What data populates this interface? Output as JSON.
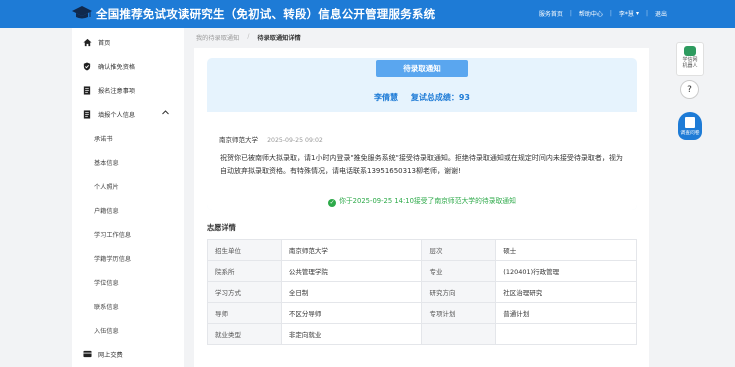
{
  "header": {
    "title": "全国推荐免试攻读研究生（免初试、转段）信息公开管理服务系统",
    "nav": [
      "服务首页",
      "帮助中心",
      "李*慧",
      "退出"
    ]
  },
  "sidebar": {
    "items": [
      {
        "label": "首页",
        "icon": "home-icon"
      },
      {
        "label": "确认推免资格",
        "icon": "shield-icon"
      },
      {
        "label": "报名注意事项",
        "icon": "document-icon"
      },
      {
        "label": "填报个人信息",
        "icon": "document-icon"
      },
      {
        "label": "承诺书"
      },
      {
        "label": "基本信息"
      },
      {
        "label": "个人照片"
      },
      {
        "label": "户籍信息"
      },
      {
        "label": "学习工作信息"
      },
      {
        "label": "学籍学历信息"
      },
      {
        "label": "学位信息"
      },
      {
        "label": "联系信息"
      },
      {
        "label": "入伍信息"
      },
      {
        "label": "网上交费",
        "icon": "payment-icon"
      }
    ]
  },
  "breadcrumb": {
    "parent": "我的待录取通知",
    "current": "待录取通知详情"
  },
  "notice": {
    "ribbon": "待录取通知",
    "student": "李倩慧",
    "score_label": "复试总成绩：93",
    "school": "南京师范大学",
    "time": "2025-09-25 09:02",
    "body": "祝贺你已被南师大拟录取，请1小时内登录\"推免服务系统\"接受待录取通知。拒绝待录取通知或在规定时间内未接受待录取者，视为自动放弃拟录取资格。有特殊情况，请电话联系13951650313柳老师，谢谢!",
    "accepted": "你于2025-09-25 14:10接受了南京师范大学的待录取通知"
  },
  "detail": {
    "title": "志愿详情",
    "rows": [
      [
        "招生单位",
        "南京师范大学",
        "层次",
        "硕士"
      ],
      [
        "院系所",
        "公共管理学院",
        "专业",
        "(120401)行政管理"
      ],
      [
        "学习方式",
        "全日制",
        "研究方向",
        "社区治理研究"
      ],
      [
        "导师",
        "不区分导师",
        "专项计划",
        "普通计划"
      ],
      [
        "就业类型",
        "非定向就业",
        "",
        ""
      ]
    ]
  },
  "float": {
    "robot": "学信网\n机器人",
    "help": "?",
    "survey": "调查问卷"
  },
  "colors": {
    "primary": "#1e7bd6",
    "success": "#2eaa4a",
    "notice_bg": "#e6f3fd"
  }
}
